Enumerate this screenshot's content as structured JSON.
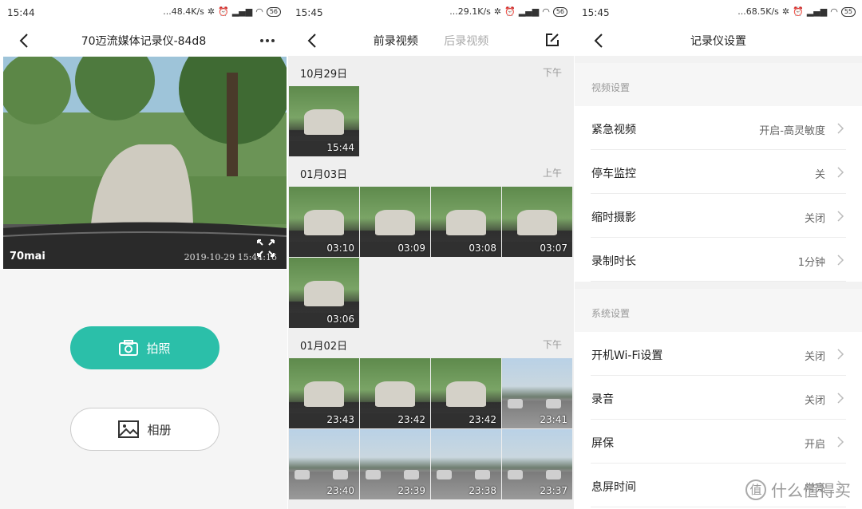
{
  "colors": {
    "accent": "#2bbfa9",
    "divider": "#ececec"
  },
  "panel1": {
    "status": {
      "time": "15:44",
      "net": "...48.4K/s",
      "battery": "56"
    },
    "title": "70迈流媒体记录仪-84d8",
    "video": {
      "brand": "70mai",
      "timestamp": "2019-10-29  15:44:16"
    },
    "photo_button": "拍照",
    "album_button": "相册"
  },
  "panel2": {
    "status": {
      "time": "15:45",
      "net": "...29.1K/s",
      "battery": "56"
    },
    "tabs": [
      "前录视频",
      "后录视频"
    ],
    "groups": [
      {
        "date": "10月29日",
        "period": "下午",
        "thumbs": [
          "15:44"
        ]
      },
      {
        "date": "01月03日",
        "period": "上午",
        "thumbs": [
          "03:10",
          "03:09",
          "03:08",
          "03:07",
          "03:06"
        ]
      },
      {
        "date": "01月02日",
        "period": "下午",
        "thumbs": [
          "23:43",
          "23:42",
          "23:42",
          "23:41",
          "23:40",
          "23:39",
          "23:38",
          "23:37"
        ]
      }
    ]
  },
  "panel3": {
    "status": {
      "time": "15:45",
      "net": "...68.5K/s",
      "battery": "55"
    },
    "title": "记录仪设置",
    "sections": [
      {
        "label": "视频设置",
        "rows": [
          {
            "label": "紧急视频",
            "value": "开启-高灵敏度"
          },
          {
            "label": "停车监控",
            "value": "关"
          },
          {
            "label": "缩时摄影",
            "value": "关闭"
          },
          {
            "label": "录制时长",
            "value": "1分钟"
          }
        ]
      },
      {
        "label": "系统设置",
        "rows": [
          {
            "label": "开机Wi-Fi设置",
            "value": "关闭"
          },
          {
            "label": "录音",
            "value": "关闭"
          },
          {
            "label": "屏保",
            "value": "开启"
          },
          {
            "label": "息屏时间",
            "value": "常亮"
          }
        ]
      }
    ],
    "watermark": "什么值得买"
  }
}
